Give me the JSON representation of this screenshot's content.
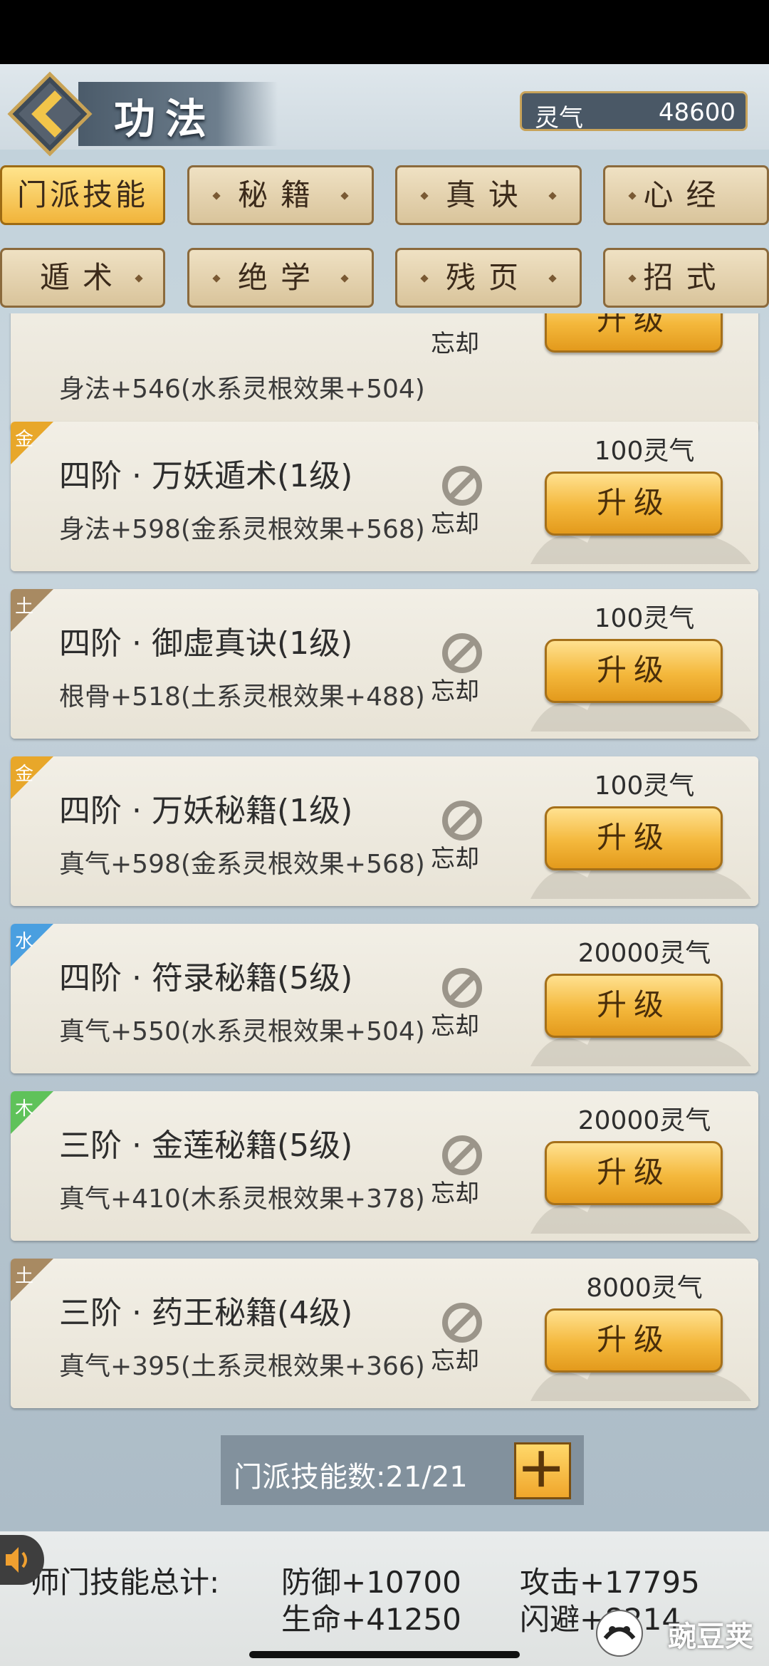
{
  "header": {
    "title": "功法",
    "qi_label": "灵气",
    "qi_value": "48600"
  },
  "tabs": [
    {
      "label": "门派技能",
      "active": true
    },
    {
      "label": "秘籍",
      "active": false
    },
    {
      "label": "真诀",
      "active": false
    },
    {
      "label": "心经",
      "active": false
    },
    {
      "label": "遁术",
      "active": false
    },
    {
      "label": "绝学",
      "active": false
    },
    {
      "label": "残页",
      "active": false
    },
    {
      "label": "招式",
      "active": false
    }
  ],
  "skills": [
    {
      "element": "",
      "name": "",
      "desc": "身法+546(水系灵根效果+504)",
      "cost": "",
      "forget": "忘却",
      "upgrade": "升级"
    },
    {
      "element": "金",
      "element_color": "#e8a72a",
      "name": "四阶 · 万妖遁术(1级)",
      "desc": "身法+598(金系灵根效果+568)",
      "cost": "100灵气",
      "forget": "忘却",
      "upgrade": "升级"
    },
    {
      "element": "土",
      "element_color": "#a88a62",
      "name": "四阶 · 御虚真诀(1级)",
      "desc": "根骨+518(土系灵根效果+488)",
      "cost": "100灵气",
      "forget": "忘却",
      "upgrade": "升级"
    },
    {
      "element": "金",
      "element_color": "#e8a72a",
      "name": "四阶 · 万妖秘籍(1级)",
      "desc": "真气+598(金系灵根效果+568)",
      "cost": "100灵气",
      "forget": "忘却",
      "upgrade": "升级"
    },
    {
      "element": "水",
      "element_color": "#4a9fe0",
      "name": "四阶 · 符录秘籍(5级)",
      "desc": "真气+550(水系灵根效果+504)",
      "cost": "20000灵气",
      "forget": "忘却",
      "upgrade": "升级"
    },
    {
      "element": "木",
      "element_color": "#5fc25a",
      "name": "三阶 · 金莲秘籍(5级)",
      "desc": "真气+410(木系灵根效果+378)",
      "cost": "20000灵气",
      "forget": "忘却",
      "upgrade": "升级"
    },
    {
      "element": "土",
      "element_color": "#a88a62",
      "name": "三阶 · 药王秘籍(4级)",
      "desc": "真气+395(土系灵根效果+366)",
      "cost": "8000灵气",
      "forget": "忘却",
      "upgrade": "升级"
    }
  ],
  "footer": {
    "count_text": "门派技能数:21/21",
    "summary_label": "师门技能总计:",
    "stats": [
      "防御+10700",
      "攻击+17795",
      "生命+41250",
      "闪避+8214"
    ],
    "watermark": "豌豆荚"
  }
}
